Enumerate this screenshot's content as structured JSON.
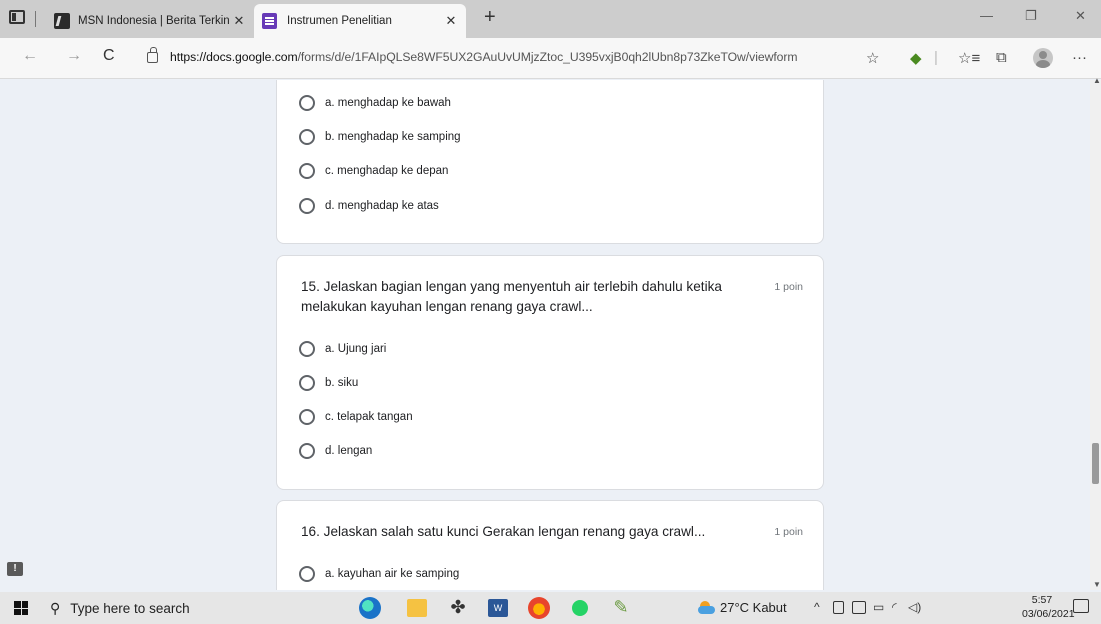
{
  "browser": {
    "tabs": [
      {
        "title": "MSN Indonesia | Berita Terkini H",
        "close": "✕"
      },
      {
        "title": "Instrumen Penelitian",
        "close": "✕"
      }
    ],
    "new_tab": "+",
    "window_controls": {
      "minimize": "—",
      "restore": "❐",
      "close": "✕"
    },
    "url_host": "https://docs.google.com",
    "url_path": "/forms/d/e/1FAIpQLSe8WF5UX2GAuUvUMjzZtoc_U395vxjB0qh2lUbn8p73ZkeTOw/viewform",
    "icons": {
      "back": "←",
      "forward": "→",
      "refresh": "C",
      "favorite": "☆",
      "extension": "◆",
      "favorites_list": "☆≡",
      "collections": "⧉",
      "more": "···"
    }
  },
  "form": {
    "prev_question": {
      "options": [
        "a. menghadap ke bawah",
        "b. menghadap ke samping",
        "c. menghadap ke depan",
        "d. menghadap ke atas"
      ]
    },
    "question15": {
      "title": "15. Jelaskan bagian lengan yang menyentuh air terlebih dahulu ketika melakukan kayuhan lengan renang gaya crawl...",
      "points": "1 poin",
      "options": [
        "a. Ujung jari",
        "b. siku",
        "c. telapak tangan",
        "d. lengan"
      ]
    },
    "question16": {
      "title": "16. Jelaskan salah satu kunci Gerakan lengan renang gaya crawl...",
      "points": "1 poin",
      "options": [
        "a. kayuhan air ke samping"
      ]
    }
  },
  "feedback_icon": "!",
  "taskbar": {
    "search_placeholder": "Type here to search",
    "search_glyph": "⚲",
    "weather": "27°C  Kabut",
    "tray": {
      "chevron": "^",
      "battery": "▭",
      "wifi": "◜",
      "volume": "◁)"
    },
    "time": "5:57",
    "date": "03/06/2021"
  },
  "colors": {
    "forms_purple": "#673ab7",
    "page_bg": "#ecf0f6"
  }
}
